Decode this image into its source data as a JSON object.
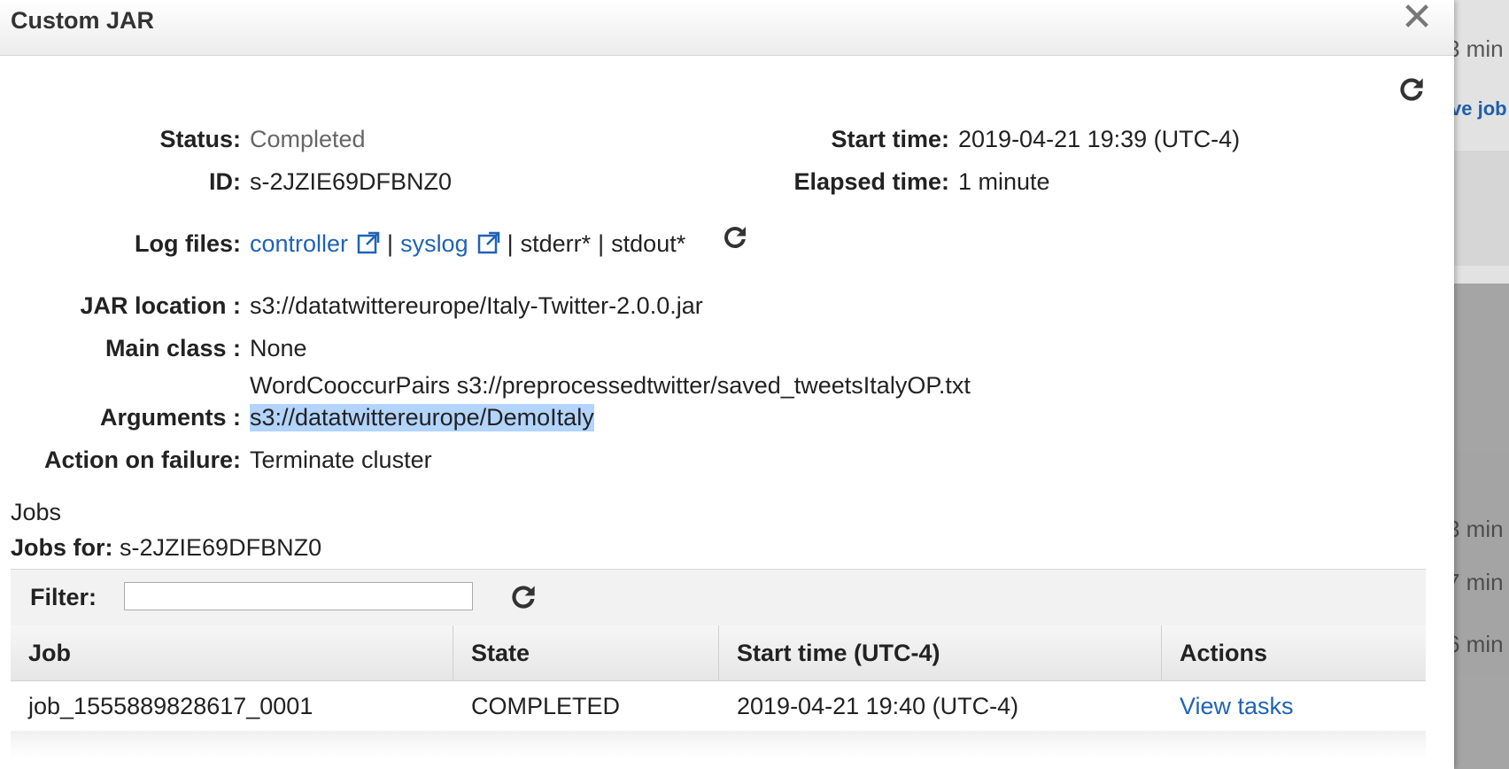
{
  "background": {
    "snippets": [
      "3 min",
      "ve job",
      "3 min",
      "7 min",
      "6 min"
    ]
  },
  "dialog": {
    "title": "Custom JAR",
    "close_symbol": "✕"
  },
  "details": {
    "status_label": "Status:",
    "status_value": "Completed",
    "id_label": "ID:",
    "id_value": "s-2JZIE69DFBNZ0",
    "start_time_label": "Start time:",
    "start_time_value": "2019-04-21 19:39 (UTC-4)",
    "elapsed_time_label": "Elapsed time:",
    "elapsed_time_value": "1 minute",
    "log_files_label": "Log files:",
    "log_files": {
      "controller": "controller",
      "syslog": "syslog",
      "stderr": "stderr*",
      "stdout": "stdout*",
      "separator": "|"
    },
    "jar_location_label": "JAR location :",
    "jar_location_value": "s3://datatwittereurope/Italy-Twitter-2.0.0.jar",
    "main_class_label": "Main class :",
    "main_class_value": "None",
    "arguments_label": "Arguments :",
    "arguments_line1": "WordCooccurPairs s3://preprocessedtwitter/saved_tweetsItalyOP.txt",
    "arguments_line2": "s3://datatwittereurope/DemoItaly",
    "action_on_failure_label": "Action on failure:",
    "action_on_failure_value": "Terminate cluster"
  },
  "jobs": {
    "title": "Jobs",
    "jobs_for_label": "Jobs for:",
    "jobs_for_value": "s-2JZIE69DFBNZ0",
    "filter_label": "Filter:",
    "filter_value": "",
    "columns": [
      "Job",
      "State",
      "Start time (UTC-4)",
      "Actions"
    ],
    "rows": [
      {
        "job": "job_1555889828617_0001",
        "state": "COMPLETED",
        "start_time": "2019-04-21 19:40 (UTC-4)",
        "action": "View tasks"
      }
    ]
  },
  "colors": {
    "link": "#1f63b5",
    "highlight": "#b3d4fc"
  },
  "icons": [
    "close-icon",
    "refresh-icon",
    "external-link-icon"
  ]
}
